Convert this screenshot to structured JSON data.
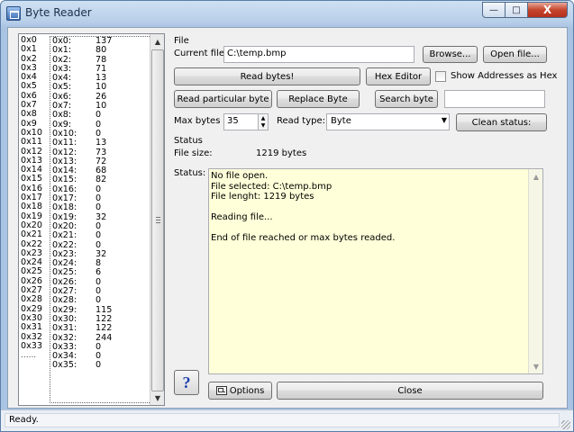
{
  "window": {
    "title": "Byte Reader",
    "buttons": {
      "minimize": "—",
      "maximize": "□",
      "close": "X"
    }
  },
  "list": {
    "addresses": [
      "0x0",
      "0x1",
      "0x2",
      "0x3",
      "0x4",
      "0x5",
      "0x6",
      "0x7",
      "0x8",
      "0x9",
      "0x10",
      "0x11",
      "0x12",
      "0x13",
      "0x14",
      "0x15",
      "0x16",
      "0x17",
      "0x18",
      "0x19",
      "0x20",
      "0x21",
      "0x22",
      "0x23",
      "0x24",
      "0x25",
      "0x26",
      "0x27",
      "0x28",
      "0x29",
      "0x30",
      "0x31",
      "0x32",
      "0x33"
    ],
    "more_indicator": "......",
    "entries": [
      {
        "key": "0x0:",
        "val": "137"
      },
      {
        "key": "0x1:",
        "val": "80"
      },
      {
        "key": "0x2:",
        "val": "78"
      },
      {
        "key": "0x3:",
        "val": "71"
      },
      {
        "key": "0x4:",
        "val": "13"
      },
      {
        "key": "0x5:",
        "val": "10"
      },
      {
        "key": "0x6:",
        "val": "26"
      },
      {
        "key": "0x7:",
        "val": "10"
      },
      {
        "key": "0x8:",
        "val": "0"
      },
      {
        "key": "0x9:",
        "val": "0"
      },
      {
        "key": "0x10:",
        "val": "0"
      },
      {
        "key": "0x11:",
        "val": "13"
      },
      {
        "key": "0x12:",
        "val": "73"
      },
      {
        "key": "0x13:",
        "val": "72"
      },
      {
        "key": "0x14:",
        "val": "68"
      },
      {
        "key": "0x15:",
        "val": "82"
      },
      {
        "key": "0x16:",
        "val": "0"
      },
      {
        "key": "0x17:",
        "val": "0"
      },
      {
        "key": "0x18:",
        "val": "0"
      },
      {
        "key": "0x19:",
        "val": "32"
      },
      {
        "key": "0x20:",
        "val": "0"
      },
      {
        "key": "0x21:",
        "val": "0"
      },
      {
        "key": "0x22:",
        "val": "0"
      },
      {
        "key": "0x23:",
        "val": "32"
      },
      {
        "key": "0x24:",
        "val": "8"
      },
      {
        "key": "0x25:",
        "val": "6"
      },
      {
        "key": "0x26:",
        "val": "0"
      },
      {
        "key": "0x27:",
        "val": "0"
      },
      {
        "key": "0x28:",
        "val": "0"
      },
      {
        "key": "0x29:",
        "val": "115"
      },
      {
        "key": "0x30:",
        "val": "122"
      },
      {
        "key": "0x31:",
        "val": "122"
      },
      {
        "key": "0x32:",
        "val": "244"
      },
      {
        "key": "0x33:",
        "val": "0"
      },
      {
        "key": "0x34:",
        "val": "0"
      },
      {
        "key": "0x35:",
        "val": "0"
      }
    ]
  },
  "file": {
    "group_label": "File",
    "current_file_label": "Current file:",
    "current_file_value": "C:\\temp.bmp",
    "browse_label": "Browse...",
    "open_file_label": "Open file..."
  },
  "actions": {
    "read_bytes": "Read bytes!",
    "hex_editor": "Hex Editor",
    "show_hex_label": "Show Addresses as Hex",
    "read_particular": "Read particular byte",
    "replace_byte": "Replace Byte",
    "search_byte": "Search byte",
    "search_value": "",
    "max_bytes_label": "Max bytes",
    "max_bytes_value": "35",
    "read_type_label": "Read type:",
    "read_type_value": "Byte",
    "clean_status": "Clean status:"
  },
  "status": {
    "group_label": "Status",
    "file_size_label": "File size:",
    "file_size_value": "1219 bytes",
    "status_label": "Status:",
    "lines": [
      "No file open.",
      "File selected: C:\\temp.bmp",
      "File lenght: 1219 bytes",
      "",
      "Reading file...",
      "",
      "End of file reached or max bytes readed."
    ]
  },
  "bottom": {
    "help_label": "?",
    "options_label": "Options",
    "close_label": "Close"
  },
  "statusbar": {
    "text": "Ready."
  },
  "colors": {
    "status_background": "#ffffd9",
    "help_accent": "#1c3fb0",
    "titlebar": "#b9d0ea"
  },
  "icons": {
    "app": "app-icon",
    "options": "options-icon",
    "help": "help-icon"
  }
}
